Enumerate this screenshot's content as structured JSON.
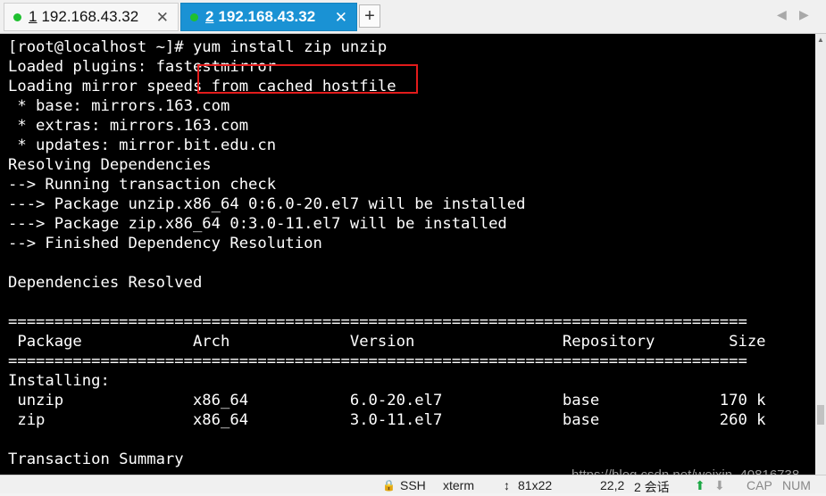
{
  "tabs": [
    {
      "number": "1",
      "title": "192.168.43.32",
      "active": false
    },
    {
      "number": "2",
      "title": "192.168.43.32",
      "active": true
    }
  ],
  "tab_close_glyph": "✕",
  "new_tab_glyph": "+",
  "nav_glyphs": {
    "left": "◀",
    "right": "▶"
  },
  "terminal": {
    "lines": [
      "[root@localhost ~]# yum install zip unzip",
      "Loaded plugins: fastestmirror",
      "Loading mirror speeds from cached hostfile",
      " * base: mirrors.163.com",
      " * extras: mirrors.163.com",
      " * updates: mirror.bit.edu.cn",
      "Resolving Dependencies",
      "--> Running transaction check",
      "---> Package unzip.x86_64 0:6.0-20.el7 will be installed",
      "---> Package zip.x86_64 0:3.0-11.el7 will be installed",
      "--> Finished Dependency Resolution",
      "",
      "Dependencies Resolved",
      "",
      "================================================================================",
      " Package            Arch             Version                Repository        Size",
      "================================================================================",
      "Installing:",
      " unzip              x86_64           6.0-20.el7             base             170 k",
      " zip                x86_64           3.0-11.el7             base             260 k",
      "",
      "Transaction Summary"
    ]
  },
  "watermark": "https://blog.csdn.net/weixin_40816738",
  "statusbar": {
    "lock_glyph": "🔒",
    "protocol": "SSH",
    "terminal_type": "xterm",
    "size_glyph": "↕",
    "size": "81x22",
    "cursor": "22,2",
    "sessions": "2 会话",
    "up_glyph": "⬆",
    "down_glyph": "⬇",
    "caps": "CAP",
    "num": "NUM"
  },
  "colors": {
    "active_tab": "#1a92d4",
    "highlight_border": "#e21b1b",
    "terminal_bg": "#000000",
    "connected_dot": "#20c030"
  }
}
